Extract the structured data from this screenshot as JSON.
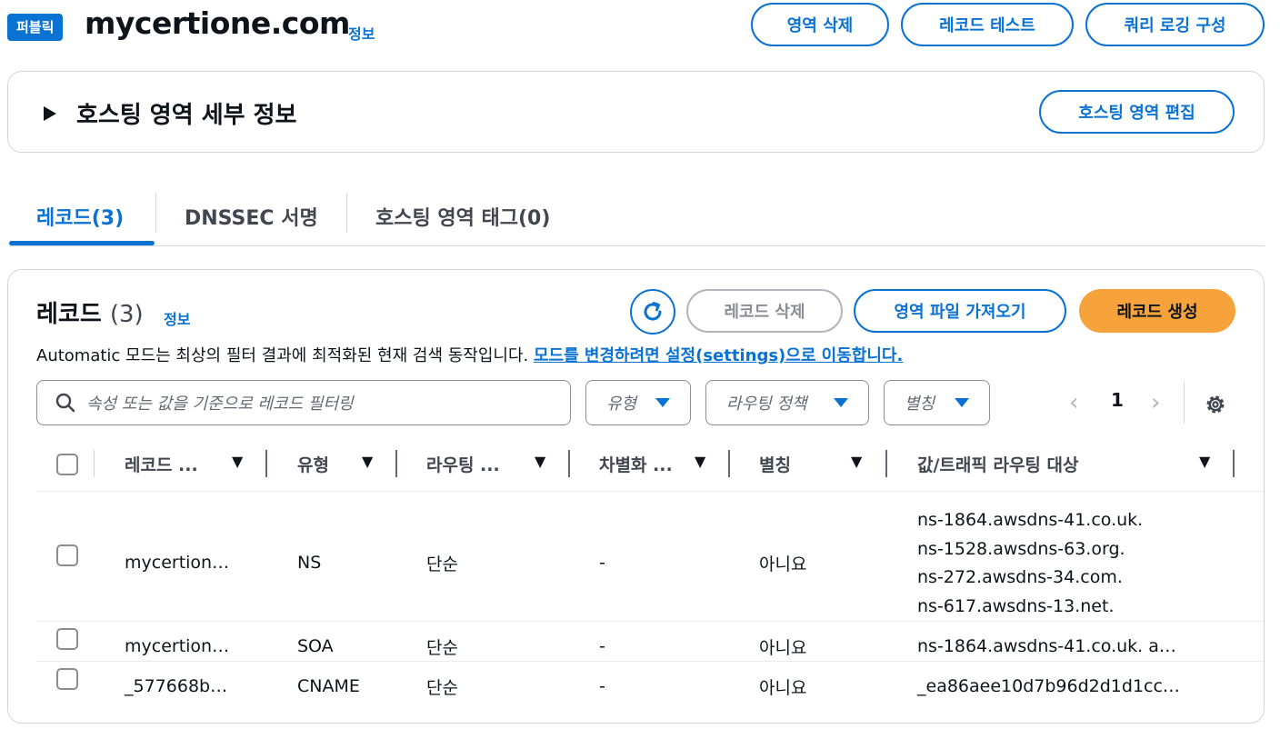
{
  "header": {
    "badge": "퍼블릭",
    "zone_name": "mycertione.com",
    "info_label": "정보",
    "buttons": {
      "delete_zone": "영역 삭제",
      "test_record": "레코드 테스트",
      "query_logging": "쿼리 로깅 구성"
    }
  },
  "details": {
    "title": "호스팅 영역 세부 정보",
    "edit_button": "호스팅 영역 편집"
  },
  "tabs": [
    {
      "label": "레코드(3)",
      "active": true
    },
    {
      "label": "DNSSEC 서명",
      "active": false
    },
    {
      "label": "호스팅 영역 태그(0)",
      "active": false
    }
  ],
  "records": {
    "title": "레코드",
    "count": "(3)",
    "info_label": "정보",
    "delete_button": "레코드 삭제",
    "import_button": "영역 파일 가져오기",
    "create_button": "레코드 생성",
    "auto_mode_text": "Automatic 모드는 최상의 필터 결과에 최적화된 현재 검색 동작입니다.",
    "auto_mode_link": "모드를 변경하려면 설정(settings)으로 이동합니다.",
    "search_placeholder": "속성 또는 값을 기준으로 레코드 필터링",
    "filters": {
      "type": "유형",
      "routing_policy": "라우팅 정책",
      "alias": "별칭"
    },
    "page": "1",
    "columns": [
      "레코드 ...",
      "유형",
      "라우팅 ...",
      "차별화 ...",
      "별칭",
      "값/트래픽 라우팅 대상"
    ],
    "rows": [
      {
        "name": "mycertion…",
        "type": "NS",
        "routing": "단순",
        "differentiator": "-",
        "alias": "아니요",
        "values": [
          "ns-1864.awsdns-41.co.uk.",
          "ns-1528.awsdns-63.org.",
          "ns-272.awsdns-34.com.",
          "ns-617.awsdns-13.net."
        ]
      },
      {
        "name": "mycertion…",
        "type": "SOA",
        "routing": "단순",
        "differentiator": "-",
        "alias": "아니요",
        "values": [
          "ns-1864.awsdns-41.co.uk. a…"
        ]
      },
      {
        "name": "_577668b…",
        "type": "CNAME",
        "routing": "단순",
        "differentiator": "-",
        "alias": "아니요",
        "values": [
          "_ea86aee10d7b96d2d1d1cc…"
        ]
      }
    ]
  },
  "colors": {
    "accent": "#0972d3",
    "primary_button": "#f5a33a",
    "border": "#d4d5da"
  },
  "icons": {
    "refresh": "refresh-icon",
    "search": "search-icon",
    "settings": "gear-icon",
    "expand": "caret-right-icon"
  }
}
